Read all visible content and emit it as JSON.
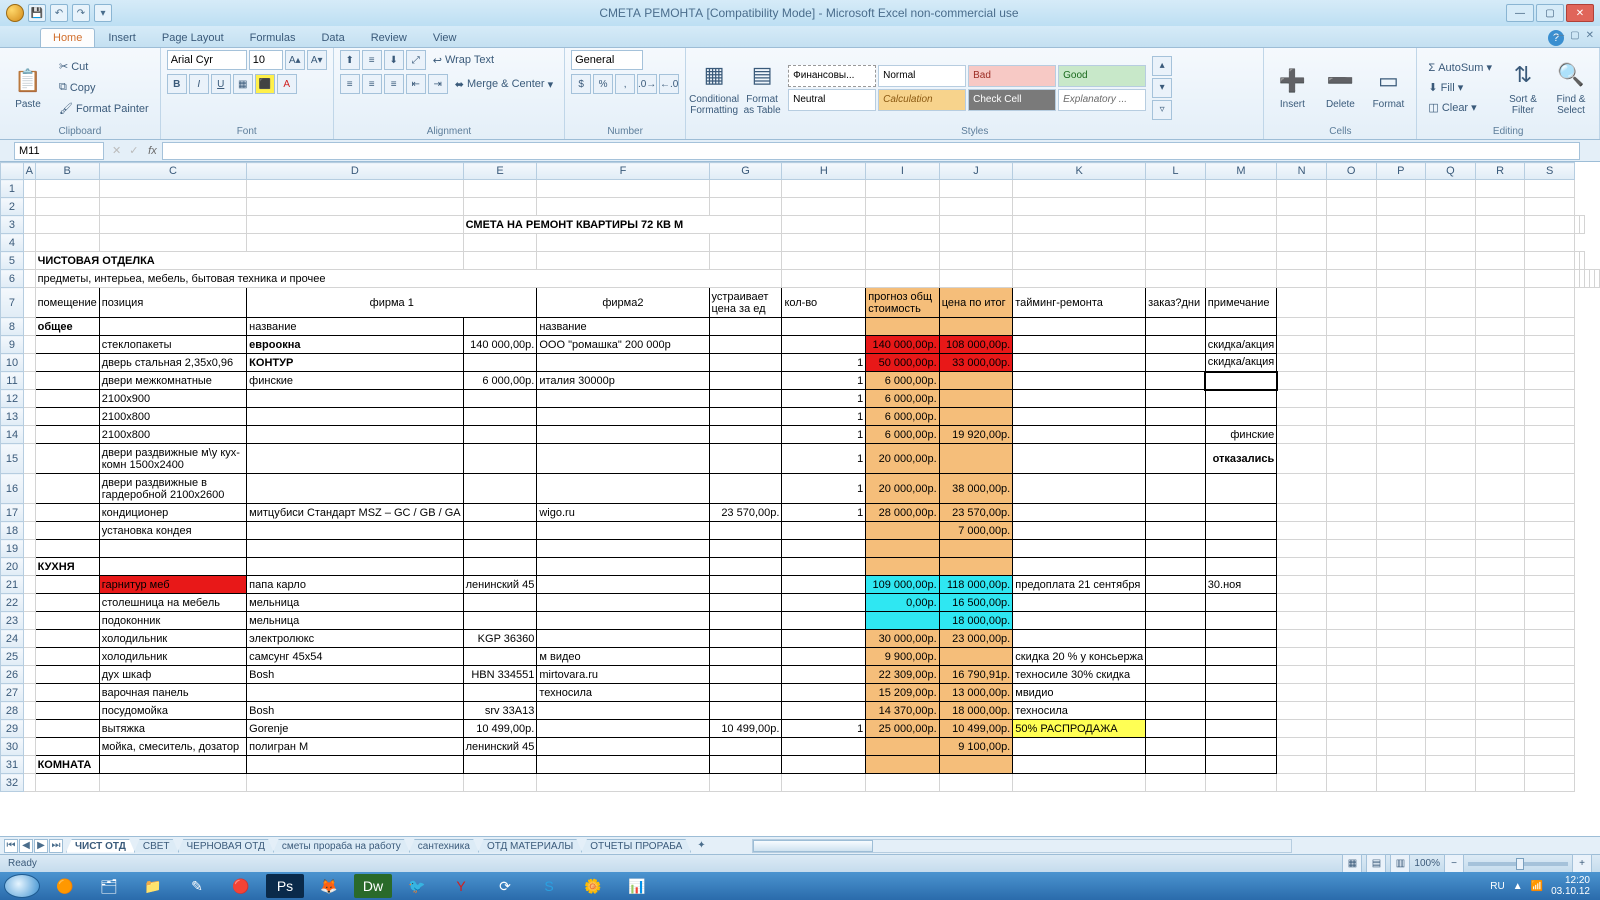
{
  "window": {
    "title": "СМЕТА РЕМОНТА  [Compatibility Mode] - Microsoft Excel non-commercial use"
  },
  "ribbon": {
    "tabs": [
      "Home",
      "Insert",
      "Page Layout",
      "Formulas",
      "Data",
      "Review",
      "View"
    ],
    "active_tab": "Home",
    "clipboard": {
      "paste": "Paste",
      "cut": "Cut",
      "copy": "Copy",
      "fmt": "Format Painter",
      "label": "Clipboard"
    },
    "font": {
      "name": "Arial Cyr",
      "size": "10",
      "label": "Font"
    },
    "alignment": {
      "wrap": "Wrap Text",
      "merge": "Merge & Center",
      "label": "Alignment"
    },
    "number": {
      "format": "General",
      "label": "Number"
    },
    "styles": {
      "cond": "Conditional Formatting",
      "fmttab": "Format as Table",
      "label": "Styles",
      "cells": [
        "Финансовы...",
        "Normal",
        "Bad",
        "Good",
        "Neutral",
        "Calculation",
        "Check Cell",
        "Explanatory ..."
      ]
    },
    "cells_group": {
      "insert": "Insert",
      "delete": "Delete",
      "format": "Format",
      "label": "Cells"
    },
    "editing": {
      "sum": "AutoSum",
      "fill": "Fill",
      "clear": "Clear",
      "sort": "Sort & Filter",
      "find": "Find & Select",
      "label": "Editing"
    }
  },
  "namebox": "M11",
  "columns": [
    "A",
    "B",
    "C",
    "D",
    "E",
    "F",
    "G",
    "H",
    "I",
    "J",
    "K",
    "L",
    "M",
    "N",
    "O",
    "P",
    "Q",
    "R",
    "S"
  ],
  "sheet": {
    "title_row": "СМЕТА НА РЕМОНТ КВАРТИРЫ 72 КВ М",
    "section1": "ЧИСТОВАЯ ОТДЕЛКА",
    "section1_sub": "предметы, интерьеа, мебель, бытовая техника и прочее",
    "headers": {
      "B": "помещение",
      "C": "позиция",
      "D": "фирма 1",
      "F": "фирма2",
      "G": "устраивает цена за ед",
      "H": "кол-во",
      "I": "прогноз общ стоимость",
      "J": "цена по итог",
      "K": "тайминг-ремонта",
      "L": "заказ?дни",
      "M": "примечание"
    },
    "row8": {
      "B": "общее",
      "D": "название",
      "F": "название"
    },
    "rows": [
      {
        "n": 9,
        "C": "стеклопакеты",
        "D": "евроокна",
        "E": "140 000,00р.",
        "F": "ООО \"ромашка\"  200 000р",
        "I": "140 000,00р.",
        "J": "108 000,00р.",
        "M": "скидка/акция",
        "red": true,
        "Dbold": true
      },
      {
        "n": 10,
        "C": "дверь стальная 2,35x0,96",
        "D": "КОНТУР",
        "H": "1",
        "I": "50 000,00р.",
        "J": "33 000,00р.",
        "M": "скидка/акция",
        "red": true,
        "Dbold": true
      },
      {
        "n": 11,
        "C": "двери межкомнатные",
        "D": "финские",
        "E": "6 000,00р.",
        "F": "италия  30000р",
        "H": "1",
        "I": "6 000,00р.",
        "sel": true
      },
      {
        "n": 12,
        "C": "2100x900",
        "H": "1",
        "I": "6 000,00р."
      },
      {
        "n": 13,
        "C": "2100x800",
        "H": "1",
        "I": "6 000,00р."
      },
      {
        "n": 14,
        "C": "2100x800",
        "H": "1",
        "I": "6 000,00р.",
        "J": "19 920,00р.",
        "M": "финские"
      },
      {
        "n": 15,
        "C": "двери раздвижные м\\у кух-комн 1500x2400",
        "H": "1",
        "I": "20 000,00р.",
        "M": "отказались",
        "tall": true,
        "Mbold": true
      },
      {
        "n": 16,
        "C": "двери раздвижные  в гардеробной 2100x2600",
        "H": "1",
        "I": "20 000,00р.",
        "J": "38 000,00р.",
        "tall": true
      },
      {
        "n": 17,
        "C": "кондиционер",
        "D": "митцубиси Стандарт MSZ – GC / GB / GA",
        "F": "wigo.ru",
        "G": "23 570,00р.",
        "H": "1",
        "I": "28 000,00р.",
        "J": "23 570,00р."
      },
      {
        "n": 18,
        "C": "установка кондея",
        "J": "7 000,00р."
      },
      {
        "n": 19
      },
      {
        "n": 20,
        "B": "КУХНЯ",
        "Bbold": true
      },
      {
        "n": 21,
        "C": "гарнитур меб",
        "D": "папа карло",
        "E": "ленинский 45",
        "I": "109 000,00р.",
        "J": "118 000,00р.",
        "K": "предоплата 21 сентября",
        "M": "30.ноя",
        "cyan": true,
        "Credhl": true
      },
      {
        "n": 22,
        "C": "столешница на мебель",
        "D": "мельница",
        "I": "0,00р.",
        "J": "16 500,00р.",
        "cyan": true
      },
      {
        "n": 23,
        "C": "подоконник",
        "D": "мельница",
        "J": "18 000,00р.",
        "cyan": true
      },
      {
        "n": 24,
        "C": "холодильник",
        "D": "электролюкс",
        "E": "KGP 36360",
        "I": "30 000,00р.",
        "J": "23 000,00р."
      },
      {
        "n": 25,
        "C": "холодильник",
        "D": "самсунг 45x54",
        "F": "м видео",
        "I": "9 900,00р.",
        "K": "скидка 20 % у консьержа"
      },
      {
        "n": 26,
        "C": "дух шкаф",
        "D": "Bosh",
        "E": "HBN 334551",
        "F": "mirtovara.ru",
        "I": "22 309,00р.",
        "J": "16 790,91р.",
        "K": "техносиле  30% скидка"
      },
      {
        "n": 27,
        "C": "варочная панель",
        "F": "техносила",
        "I": "15 209,00р.",
        "J": "13 000,00р.",
        "K": "мвидио"
      },
      {
        "n": 28,
        "C": "посудомойка",
        "D": "Bosh",
        "E": "srv 33A13",
        "I": "14 370,00р.",
        "J": "18 000,00р.",
        "K": "техносила"
      },
      {
        "n": 29,
        "C": "вытяжка",
        "D": "Gorenje",
        "E": "10 499,00р.",
        "G": "10 499,00р.",
        "H": "1",
        "I": "25 000,00р.",
        "J": "10 499,00р.",
        "K": "50% РАСПРОДАЖА",
        "Kyl": true
      },
      {
        "n": 30,
        "C": "мойка, смеситель, дозатор",
        "D": "полигран М",
        "E": "ленинский 45",
        "J": "9 100,00р."
      },
      {
        "n": 31,
        "B": "КОМНАТА",
        "Bbold": true
      }
    ]
  },
  "sheets": [
    "ЧИСТ ОТД",
    "СВЕТ",
    "ЧЕРНОВАЯ ОТД",
    "сметы прораба на работу",
    "сантехника",
    "ОТД МАТЕРИАЛЫ",
    "ОТЧЕТЫ ПРОРАБА"
  ],
  "active_sheet": 0,
  "status": {
    "ready": "Ready",
    "zoom": "100%"
  },
  "taskbar": {
    "lang": "RU",
    "time": "12:20",
    "date": "03.10.12"
  }
}
